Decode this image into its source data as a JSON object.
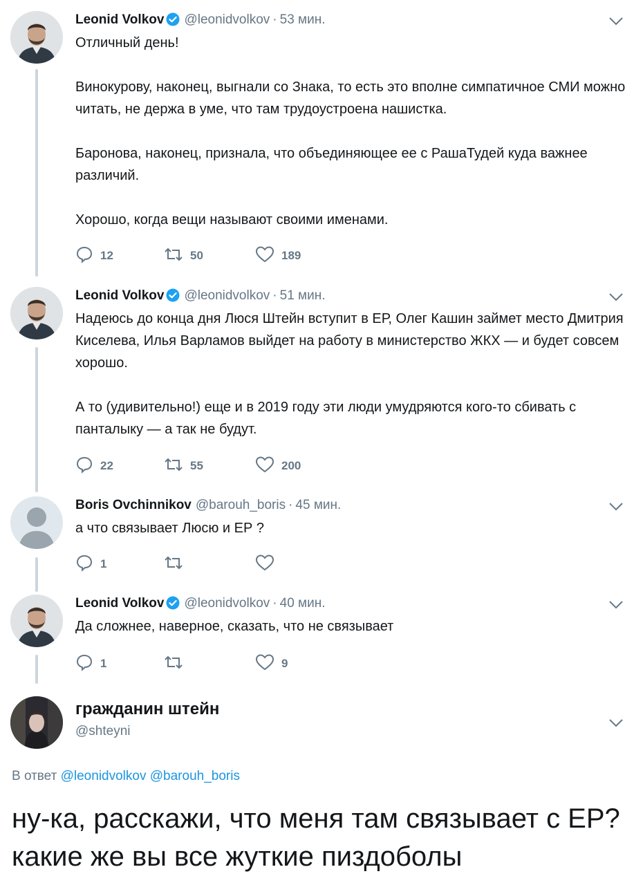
{
  "tweets": [
    {
      "author": "Leonid Volkov",
      "handle": "@leonidvolkov",
      "time": "53 мин.",
      "paragraphs": [
        "Отличный день!",
        "Винокурову, наконец, выгнали со Знака, то есть это вполне симпатичное СМИ можно читать, не держа в уме, что там трудоустроена нашистка.",
        "Баронова, наконец, признала, что объединяющее ее с РашаТудей куда важнее различий.",
        "Хорошо, когда вещи называют своими именами."
      ],
      "replies": "12",
      "retweets": "50",
      "likes": "189"
    },
    {
      "author": "Leonid Volkov",
      "handle": "@leonidvolkov",
      "time": "51 мин.",
      "paragraphs": [
        "Надеюсь до конца дня Люся Штейн вступит в ЕР, Олег Кашин займет место Дмитрия Киселева, Илья Варламов выйдет на работу в министерство ЖКХ — и будет совсем хорошо.",
        "А то (удивительно!) еще и в 2019 году эти люди умудряются кого-то сбивать с панталыку — а так не будут."
      ],
      "replies": "22",
      "retweets": "55",
      "likes": "200"
    },
    {
      "author": "Boris Ovchinnikov",
      "handle": "@barouh_boris",
      "time": "45 мин.",
      "paragraphs": [
        "а что связывает Люсю и ЕР ?"
      ],
      "replies": "1",
      "retweets": "",
      "likes": ""
    },
    {
      "author": "Leonid Volkov",
      "handle": "@leonidvolkov",
      "time": "40 мин.",
      "paragraphs": [
        "Да сложнее, наверное, сказать, что не связывает"
      ],
      "replies": "1",
      "retweets": "",
      "likes": "9"
    }
  ],
  "main_tweet": {
    "author": "гражданин штейн",
    "handle": "@shteyni",
    "reply_prefix": "В ответ",
    "reply_mention_1": "@leonidvolkov",
    "reply_mention_2": "@barouh_boris",
    "text": "ну-ка, расскажи, что меня там связывает с ЕР? какие же вы все жуткие пиздоболы"
  },
  "separator": "·",
  "colors": {
    "text": "#14171a",
    "muted": "#657786",
    "link": "#1b95e0",
    "thread_line": "#ccd6dd",
    "verified": "#1da1f2"
  },
  "icons": {
    "verified": "verified-badge-icon",
    "reply": "reply-icon",
    "retweet": "retweet-icon",
    "like": "heart-icon",
    "menu": "chevron-down-icon"
  }
}
